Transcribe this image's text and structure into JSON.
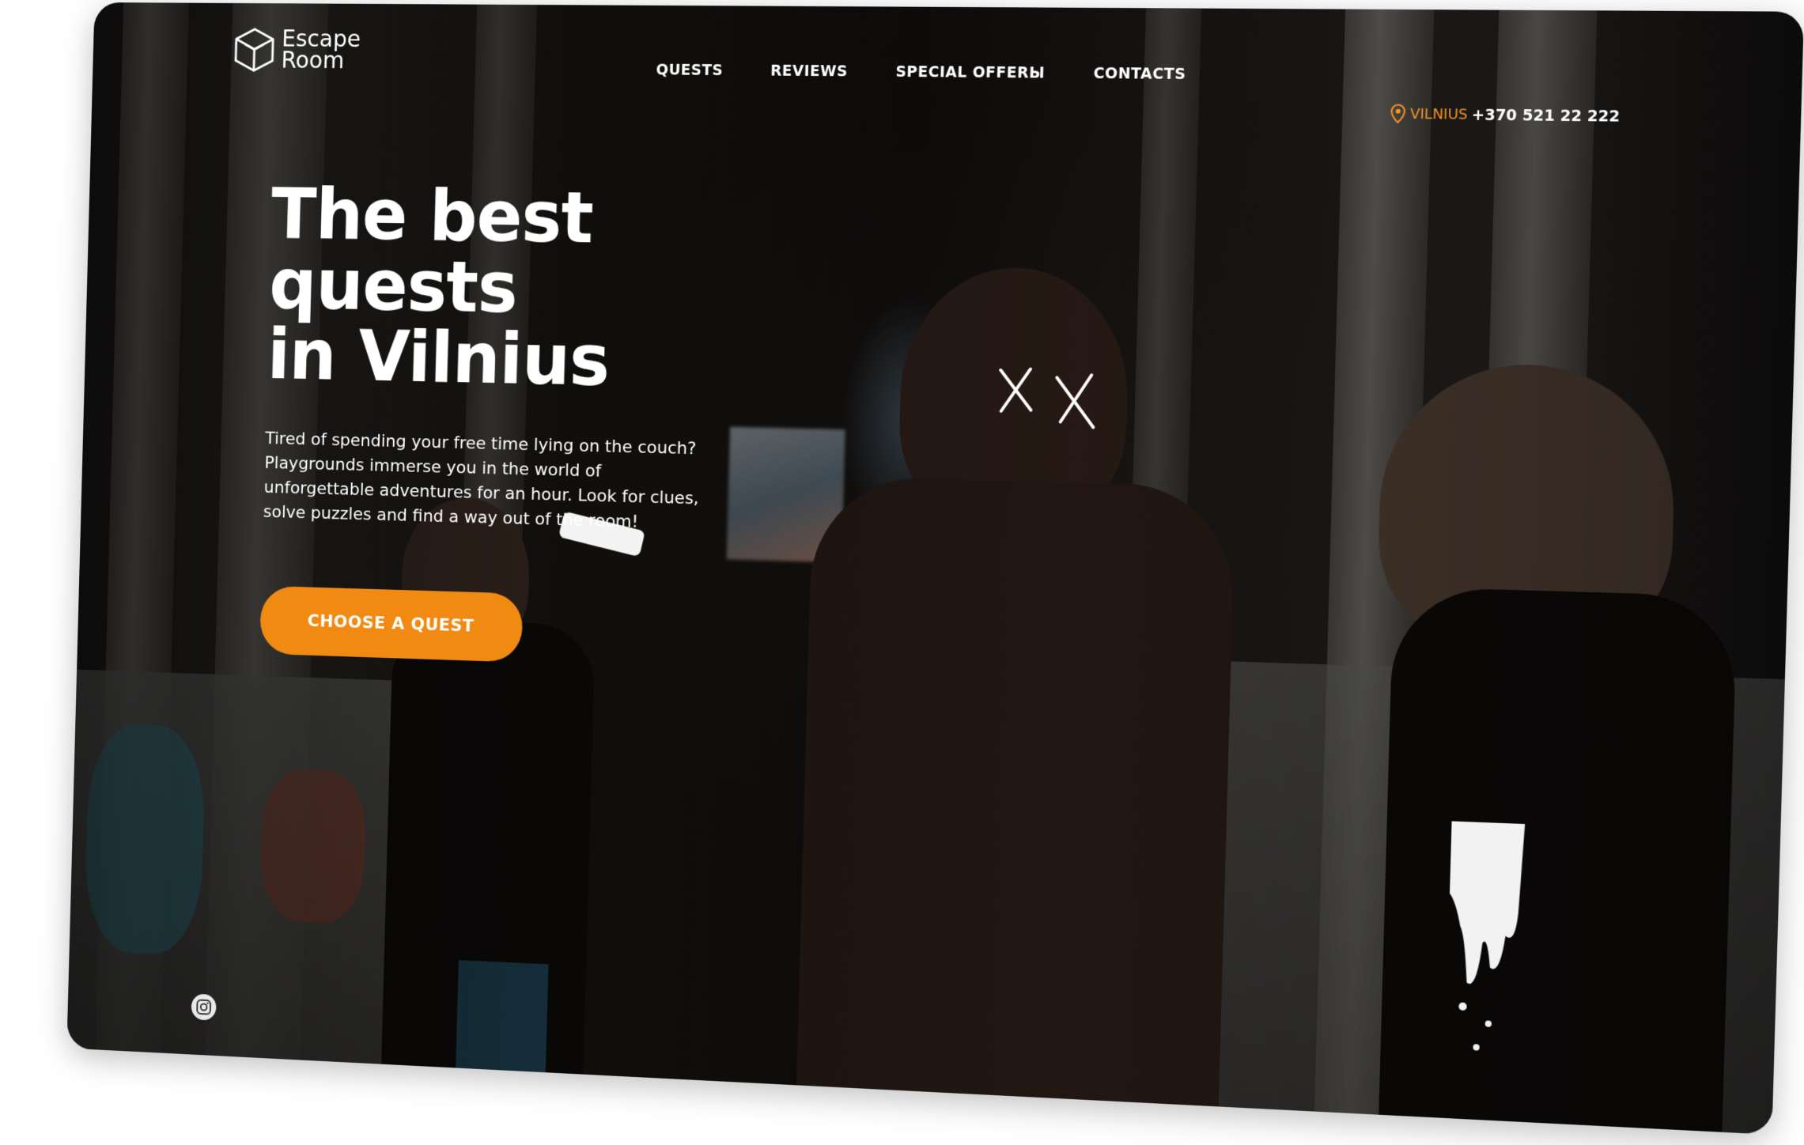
{
  "logo": {
    "line1": "Escape",
    "line2": "Room"
  },
  "nav": {
    "items": [
      {
        "label": "QUESTS"
      },
      {
        "label": "REVIEWS"
      },
      {
        "label": "SPECIAL OFFERЫ"
      },
      {
        "label": "CONTACTS"
      }
    ]
  },
  "city": {
    "label": "VILNIUS",
    "icon": "location-pin-icon"
  },
  "phone": "+370 521 22 222",
  "hero": {
    "title_line1": "The best quests",
    "title_line2": "in Vilnius",
    "description": "Tired of spending your free time lying on the couch? Playgrounds immerse you in the world of unforgettable adventures for an hour. Look for clues, solve puzzles and find a way out of the room!",
    "cta_label": "CHOOSE A QUEST"
  },
  "social": {
    "icon": "instagram-icon"
  },
  "colors": {
    "accent": "#f08a12",
    "city_text": "#f39321",
    "text": "#ffffff"
  }
}
